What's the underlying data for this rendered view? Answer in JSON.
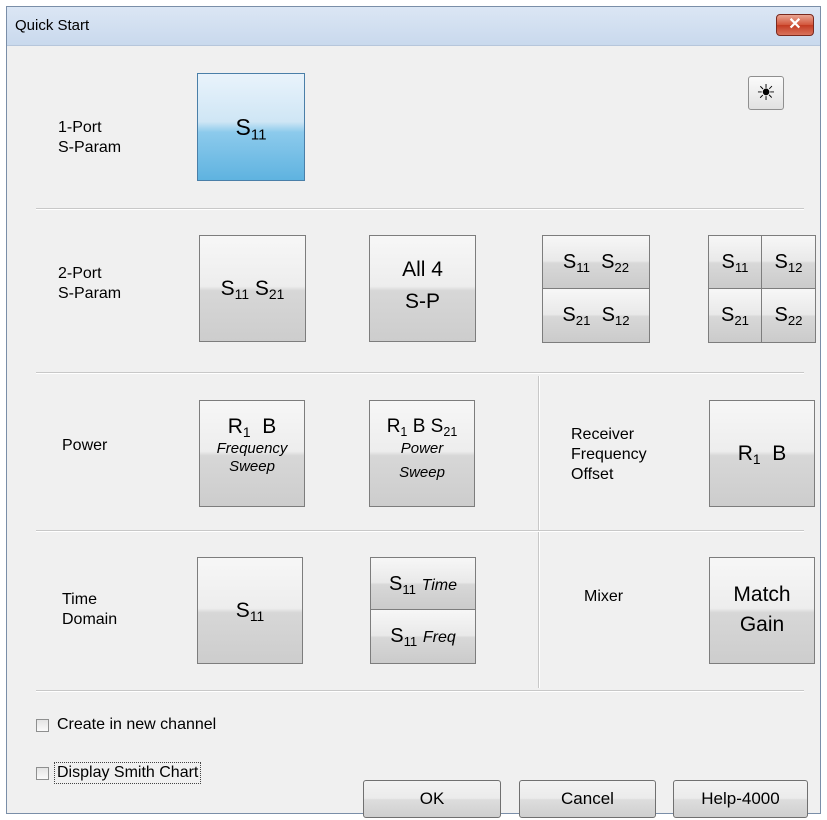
{
  "window": {
    "title": "Quick Start",
    "close_label": "✕"
  },
  "icons": {
    "brightness": "☀"
  },
  "rows": {
    "one_port": {
      "label1": "1-Port",
      "label2": "S-Param"
    },
    "two_port": {
      "label1": "2-Port",
      "label2": "S-Param"
    },
    "power": {
      "label": "Power"
    },
    "receiver": {
      "label1": "Receiver",
      "label2": "Frequency",
      "label3": "Offset"
    },
    "time_domain": {
      "label1": "Time",
      "label2": "Domain"
    },
    "mixer": {
      "label": "Mixer"
    }
  },
  "tiles": {
    "s": "S",
    "sub11": "11",
    "sub21": "21",
    "sub12": "12",
    "sub22": "22",
    "sub1": "1",
    "all4_line1": "All 4",
    "all4_line2": "S-P",
    "r": "R",
    "b": "B",
    "frequency": "Frequency",
    "sweep": "Sweep",
    "power": "Power",
    "time": "Time",
    "freq": "Freq",
    "match": "Match",
    "gain": "Gain"
  },
  "options": {
    "create_new_channel": "Create in new channel",
    "display_smith_chart": "Display Smith Chart"
  },
  "buttons": {
    "ok": "OK",
    "cancel": "Cancel",
    "help": "Help-4000"
  },
  "colors": {
    "selected_tile": "#5fb3e0",
    "close_button": "#c43b22"
  }
}
